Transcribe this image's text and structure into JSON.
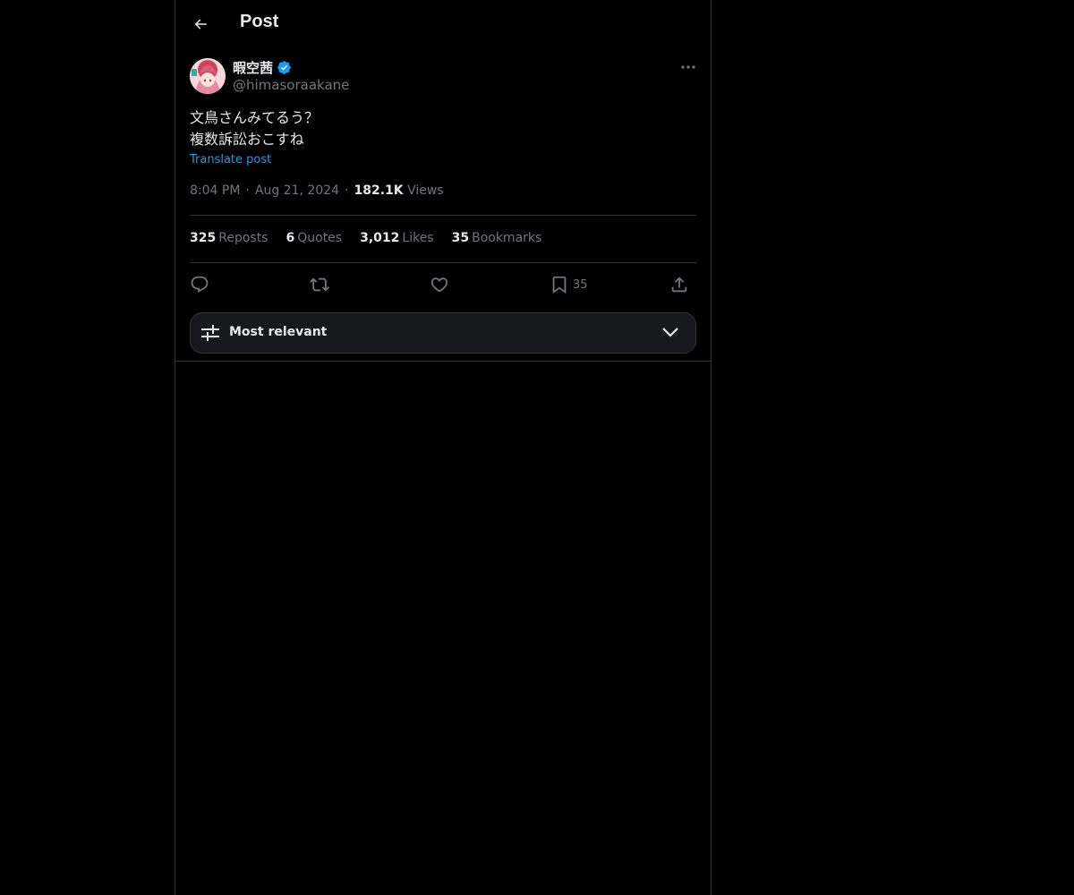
{
  "header": {
    "title": "Post"
  },
  "author": {
    "display_name": "暇空茜",
    "handle": "@himasoraakane",
    "verified": true,
    "verified_color": "#1d9bf0"
  },
  "post": {
    "lines": [
      "文鳥さんみてるう？",
      "複数訴訟おこすね"
    ],
    "translate_label": "Translate post",
    "time": "8:04 PM",
    "date": "Aug 21, 2024",
    "views_count": "182.1K",
    "views_label": "Views",
    "dot": "·"
  },
  "stats": {
    "reposts": {
      "count": "325",
      "label": "Reposts"
    },
    "quotes": {
      "count": "6",
      "label": "Quotes"
    },
    "likes": {
      "count": "3,012",
      "label": "Likes"
    },
    "bookmarks": {
      "count": "35",
      "label": "Bookmarks"
    }
  },
  "actions": {
    "bookmark_count": "35"
  },
  "sort": {
    "label": "Most relevant"
  },
  "colors": {
    "background": "#000000",
    "accent": "#1d9bf0",
    "muted": "#71767b",
    "border": "#2f3336"
  }
}
